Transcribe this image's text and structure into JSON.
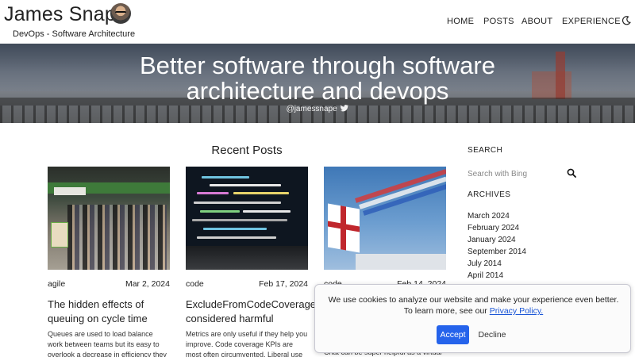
{
  "header": {
    "site_title": "James Snape",
    "tagline": "DevOps - Software Architecture",
    "nav": [
      "HOME",
      "POSTS",
      "ABOUT",
      "EXPERIENCE"
    ],
    "theme_toggle_icon": "moon-icon"
  },
  "hero": {
    "title_line1": "Better software through software",
    "title_line2": "architecture and devops",
    "handle": "@jamessnape",
    "handle_icon": "twitter-bird-icon"
  },
  "main": {
    "section_title": "Recent Posts",
    "posts": [
      {
        "category": "agile",
        "date": "Mar 2, 2024",
        "title": "The hidden effects of queuing on cycle time",
        "excerpt": "Queues are used to load balance work between teams but its easy to overlook a decrease in efficiency they"
      },
      {
        "category": "code",
        "date": "Feb 17, 2024",
        "title": "ExcludeFromCodeCoverage considered harmful",
        "excerpt": "Metrics are only useful if they help you improve. Code coverage KPIs are most often circumvented. Liberal use of the"
      },
      {
        "category": "code",
        "date": "Feb 14, 2024",
        "title": "",
        "excerpt": "Chat can be super helpful as a virtual"
      }
    ]
  },
  "sidebar": {
    "search_heading": "SEARCH",
    "search_placeholder": "Search with Bing",
    "archives_heading": "ARCHIVES",
    "archives": [
      "March 2024",
      "February 2024",
      "January 2024",
      "September 2014",
      "July 2014",
      "April 2014"
    ]
  },
  "cookie_banner": {
    "text": "We use cookies to analyze our website and make your experience even better. To learn more, see our",
    "link_text": "Privacy Policy.",
    "accept_label": "Accept",
    "decline_label": "Decline"
  }
}
